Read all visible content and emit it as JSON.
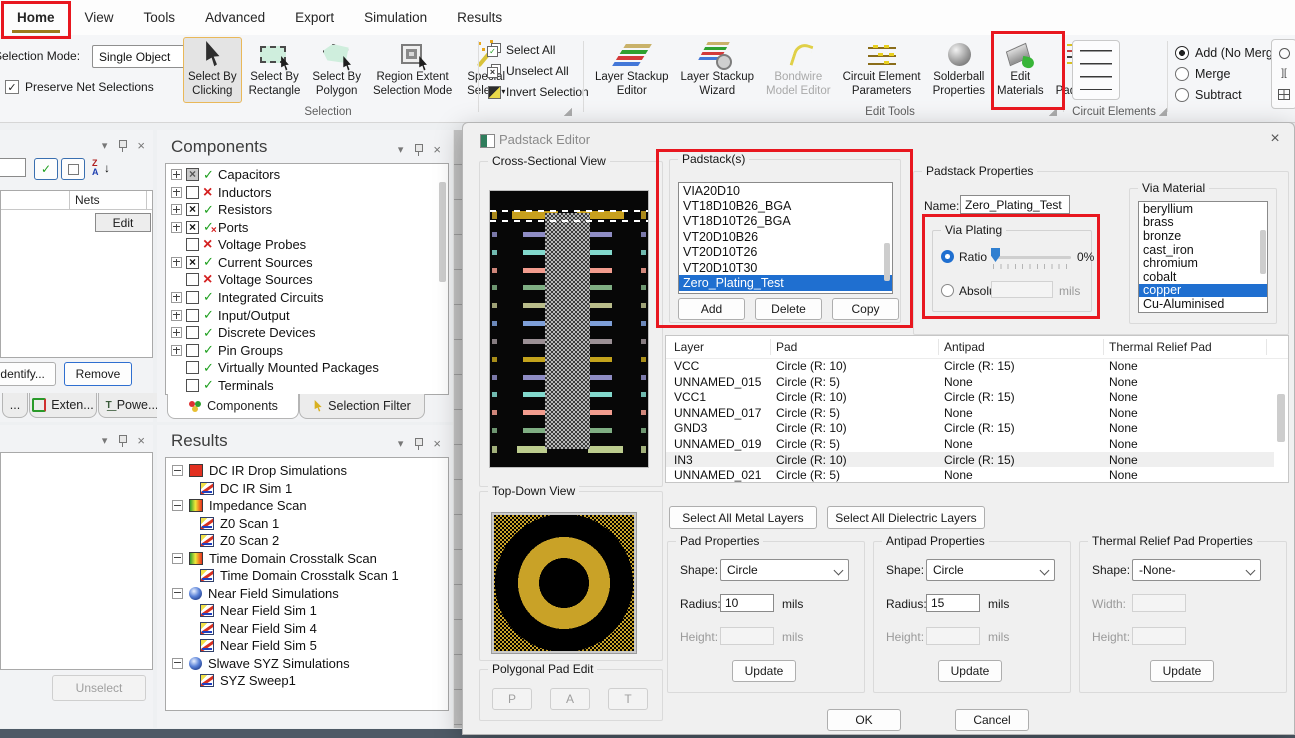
{
  "menubar": {
    "tabs": [
      {
        "label": "Home",
        "active": true
      },
      {
        "label": "View"
      },
      {
        "label": "Tools"
      },
      {
        "label": "Advanced"
      },
      {
        "label": "Export"
      },
      {
        "label": "Simulation"
      },
      {
        "label": "Results"
      }
    ]
  },
  "ribbon": {
    "selection_mode_label": "Selection Mode:",
    "selection_mode_value": "Single Object",
    "preserve_net_label": "Preserve Net Selections",
    "big_buttons": [
      {
        "label1": "Select By",
        "label2": "Clicking",
        "icon": "cursor-icon",
        "active": true
      },
      {
        "label1": "Select By",
        "label2": "Rectangle",
        "icon": "rect-select-icon"
      },
      {
        "label1": "Select By",
        "label2": "Polygon",
        "icon": "poly-select-icon"
      },
      {
        "label1": "Region Extent",
        "label2": "Selection Mode",
        "icon": "region-extent-icon"
      },
      {
        "label1": "Special",
        "label2": "Select",
        "icon": "wand-icon",
        "dropdown": true
      }
    ],
    "selection_group_label": "Selection",
    "select_buttons": [
      {
        "label": "Select All",
        "icon": "select-all-icon"
      },
      {
        "label": "Unselect All",
        "icon": "unselect-all-icon"
      },
      {
        "label": "Invert Selection",
        "icon": "invert-selection-icon"
      }
    ],
    "edit_tools_label": "Edit Tools",
    "edit_tools_buttons": [
      {
        "label1": "Layer Stackup",
        "label2": "Editor",
        "icon": "stackup-icon"
      },
      {
        "label1": "Layer Stackup",
        "label2": "Wizard",
        "icon": "stackup-wizard-icon"
      },
      {
        "label1": "Bondwire",
        "label2": "Model Editor",
        "icon": "bondwire-icon",
        "disabled": true
      },
      {
        "label1": "Circuit Element",
        "label2": "Parameters",
        "icon": "circuit-params-icon"
      },
      {
        "label1": "Solderball",
        "label2": "Properties",
        "icon": "solderball-icon"
      },
      {
        "label1": "Edit",
        "label2": "Materials",
        "icon": "materials-icon"
      },
      {
        "label1": "Edit",
        "label2": "Padstacks",
        "icon": "padstacks-icon",
        "highlighted": true
      }
    ],
    "circuit_elements_label": "Circuit Elements",
    "merge_options": [
      {
        "label": "Add (No Merge)",
        "selected": true
      },
      {
        "label": "Merge"
      },
      {
        "label": "Subtract"
      }
    ]
  },
  "nets_panel": {
    "column_header": "Nets",
    "edit_button": "Edit",
    "identify_button": "Identify...",
    "remove_button": "Remove",
    "tabs": [
      "...",
      "Exten...",
      "Powe..."
    ],
    "unselect_button": "Unselect"
  },
  "components_panel": {
    "title": "Components",
    "items": [
      {
        "label": "Capacitors",
        "expand": true,
        "check": "gray",
        "status": "ok"
      },
      {
        "label": "Inductors",
        "expand": true,
        "check": "off",
        "status": "bad"
      },
      {
        "label": "Resistors",
        "expand": true,
        "check": "on",
        "status": "ok"
      },
      {
        "label": "Ports",
        "expand": true,
        "check": "on",
        "status": "mixed"
      },
      {
        "label": "Voltage Probes",
        "expand": false,
        "check": "off",
        "status": "bad"
      },
      {
        "label": "Current Sources",
        "expand": true,
        "check": "on",
        "status": "ok"
      },
      {
        "label": "Voltage Sources",
        "expand": false,
        "check": "off",
        "status": "bad"
      },
      {
        "label": "Integrated Circuits",
        "expand": true,
        "check": "off",
        "status": "ok"
      },
      {
        "label": "Input/Output",
        "expand": true,
        "check": "off",
        "status": "ok"
      },
      {
        "label": "Discrete Devices",
        "expand": true,
        "check": "off",
        "status": "ok"
      },
      {
        "label": "Pin Groups",
        "expand": true,
        "check": "off",
        "status": "ok"
      },
      {
        "label": "Virtually Mounted Packages",
        "expand": false,
        "check": "off",
        "status": "ok"
      },
      {
        "label": "Terminals",
        "expand": false,
        "check": "off",
        "status": "ok"
      }
    ],
    "tab_components": "Components",
    "tab_selection_filter": "Selection Filter"
  },
  "results_panel": {
    "title": "Results",
    "items": [
      {
        "label": "DC IR Drop Simulations",
        "icon": "red-square-icon",
        "level": 0
      },
      {
        "label": "DC IR Sim 1",
        "icon": "chart-icon",
        "level": 1
      },
      {
        "label": "Impedance Scan",
        "icon": "gradient-square-icon",
        "level": 0
      },
      {
        "label": "Z0 Scan 1",
        "icon": "chart-icon",
        "level": 1
      },
      {
        "label": "Z0 Scan 2",
        "icon": "chart-icon",
        "level": 1
      },
      {
        "label": "Time Domain Crosstalk Scan",
        "icon": "gradient-square-icon",
        "level": 0
      },
      {
        "label": "Time Domain Crosstalk Scan 1",
        "icon": "chart-icon",
        "level": 1
      },
      {
        "label": "Near Field Simulations",
        "icon": "globe-icon",
        "level": 0
      },
      {
        "label": "Near Field Sim 1",
        "icon": "chart-icon",
        "level": 1
      },
      {
        "label": "Near Field Sim 4",
        "icon": "chart-icon",
        "level": 1
      },
      {
        "label": "Near Field Sim 5",
        "icon": "chart-icon",
        "level": 1
      },
      {
        "label": "Slwave SYZ Simulations",
        "icon": "globe-icon",
        "level": 0
      },
      {
        "label": "SYZ Sweep1",
        "icon": "chart-icon",
        "level": 1
      }
    ]
  },
  "dialog": {
    "title": "Padstack Editor",
    "cross_section": {
      "label": "Cross-Sectional View",
      "bars": [
        {
          "color": "#c8a01e",
          "top": true
        },
        {
          "color": "#8e8cc4"
        },
        {
          "color": "#82d8cc"
        },
        {
          "color": "#f29c8e"
        },
        {
          "color": "#7fae83"
        },
        {
          "color": "#b9bc8a"
        },
        {
          "color": "#7e9fd8"
        },
        {
          "color": "#9b9095"
        },
        {
          "color": "#c3a31c"
        },
        {
          "color": "#8e8cc4"
        },
        {
          "color": "#82d8cc"
        },
        {
          "color": "#f29c8e"
        },
        {
          "color": "#7fae83"
        },
        {
          "color": "#bccc8e",
          "thick": true
        }
      ]
    },
    "top_down": {
      "label": "Top-Down View"
    },
    "polygonal": {
      "label": "Polygonal Pad Edit",
      "buttons": [
        "P",
        "A",
        "T"
      ]
    },
    "padstacks": {
      "label": "Padstack(s)",
      "items": [
        {
          "name": "VIA20D10"
        },
        {
          "name": "VT18D10B26_BGA"
        },
        {
          "name": "VT18D10T26_BGA"
        },
        {
          "name": "VT20D10B26"
        },
        {
          "name": "VT20D10T26"
        },
        {
          "name": "VT20D10T30"
        },
        {
          "name": "Zero_Plating_Test",
          "selected": true
        }
      ],
      "buttons": [
        "Add",
        "Delete",
        "Copy"
      ]
    },
    "properties": {
      "label": "Padstack Properties",
      "name_label": "Name:",
      "name_value": "Zero_Plating_Test",
      "via_plating": {
        "label": "Via Plating",
        "ratio_label": "Ratio",
        "ratio_value": "0%",
        "absolute_label": "Absolute",
        "absolute_unit": "mils"
      },
      "via_material": {
        "label": "Via Material",
        "items": [
          {
            "name": "beryllium"
          },
          {
            "name": "brass"
          },
          {
            "name": "bronze"
          },
          {
            "name": "cast_iron"
          },
          {
            "name": "chromium"
          },
          {
            "name": "cobalt"
          },
          {
            "name": "copper",
            "selected": true
          },
          {
            "name": "Cu-Aluminised"
          }
        ]
      }
    },
    "layer_table": {
      "headers": [
        "Layer",
        "Pad",
        "Antipad",
        "Thermal Relief Pad"
      ],
      "rows": [
        {
          "cells": [
            "VCC",
            "Circle (R: 10)",
            "Circle (R: 15)",
            "None"
          ]
        },
        {
          "cells": [
            "UNNAMED_015",
            "Circle (R: 5)",
            "None",
            "None"
          ]
        },
        {
          "cells": [
            "VCC1",
            "Circle (R: 10)",
            "Circle (R: 15)",
            "None"
          ]
        },
        {
          "cells": [
            "UNNAMED_017",
            "Circle (R: 5)",
            "None",
            "None"
          ]
        },
        {
          "cells": [
            "GND3",
            "Circle (R: 10)",
            "Circle (R: 15)",
            "None"
          ]
        },
        {
          "cells": [
            "UNNAMED_019",
            "Circle (R: 5)",
            "None",
            "None"
          ]
        },
        {
          "cells": [
            "IN3",
            "Circle (R: 10)",
            "Circle (R: 15)",
            "None"
          ],
          "highlighted": true
        },
        {
          "cells": [
            "UNNAMED_021",
            "Circle (R: 5)",
            "None",
            "None"
          ]
        }
      ]
    },
    "select_metal_button": "Select All Metal Layers",
    "select_dielectric_button": "Select All Dielectric Layers",
    "pad_properties": {
      "label": "Pad Properties",
      "shape_label": "Shape:",
      "shape_value": "Circle",
      "radius_label": "Radius:",
      "radius_value": "10",
      "radius_unit": "mils",
      "height_label": "Height:",
      "height_unit": "mils",
      "update_button": "Update"
    },
    "antipad_properties": {
      "label": "Antipad Properties",
      "shape_label": "Shape:",
      "shape_value": "Circle",
      "radius_label": "Radius:",
      "radius_value": "15",
      "radius_unit": "mils",
      "height_label": "Height:",
      "height_unit": "mils",
      "update_button": "Update"
    },
    "thermal_properties": {
      "label": "Thermal Relief Pad Properties",
      "shape_label": "Shape:",
      "shape_value": "-None-",
      "width_label": "Width:",
      "height_label": "Height:",
      "update_button": "Update"
    },
    "ok_button": "OK",
    "cancel_button": "Cancel"
  }
}
